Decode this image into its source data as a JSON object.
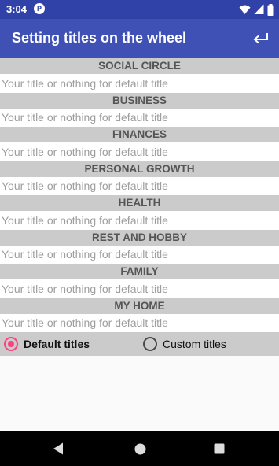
{
  "status_bar": {
    "time": "3:04",
    "badge": "P",
    "icons": [
      "wifi-icon",
      "signal-icon",
      "battery-icon"
    ]
  },
  "app_bar": {
    "title": "Setting titles on the wheel",
    "back_icon": "return-arrow-icon"
  },
  "input_placeholder": "Your title or nothing for default title",
  "sections": [
    {
      "title": "SOCIAL CIRCLE",
      "value": ""
    },
    {
      "title": "BUSINESS",
      "value": ""
    },
    {
      "title": "FINANCES",
      "value": ""
    },
    {
      "title": "PERSONAL GROWTH",
      "value": ""
    },
    {
      "title": "HEALTH",
      "value": ""
    },
    {
      "title": "REST AND HOBBY",
      "value": ""
    },
    {
      "title": "FAMILY",
      "value": ""
    },
    {
      "title": "MY HOME",
      "value": ""
    }
  ],
  "title_mode": {
    "default_label": "Default titles",
    "custom_label": "Custom titles",
    "selected": "default"
  },
  "colors": {
    "status_bar": "#3042a8",
    "app_bar": "#3f51b5",
    "accent": "#ff4081",
    "section_header_bg": "#cbcbcb"
  },
  "nav_bar": {
    "icons": [
      "back-triangle-icon",
      "home-circle-icon",
      "recents-square-icon"
    ]
  }
}
